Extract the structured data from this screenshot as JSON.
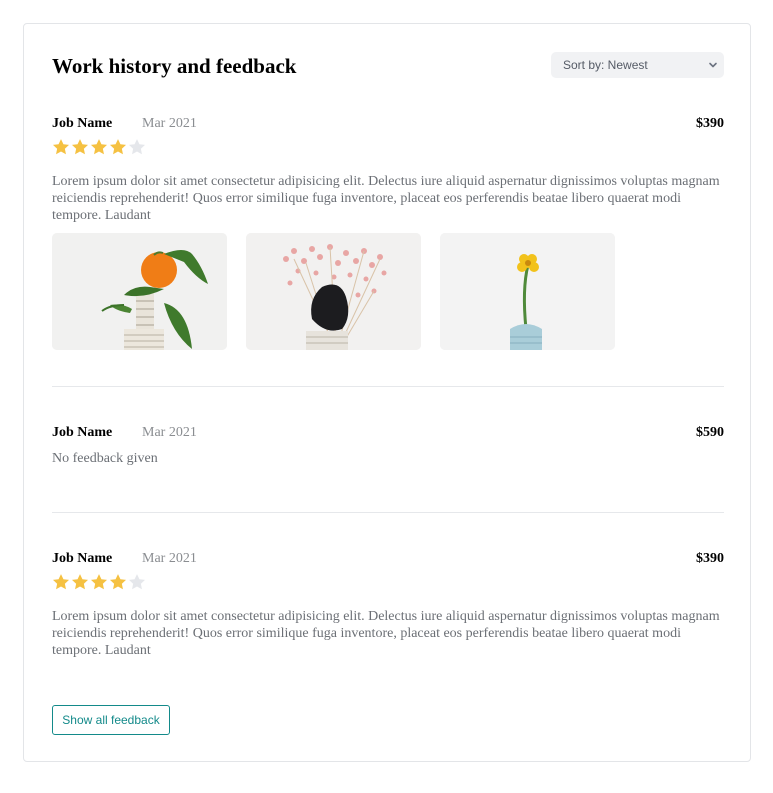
{
  "title": "Work history and feedback",
  "sort": {
    "label": "Sort by: Newest",
    "icon": "chevron-down-icon"
  },
  "colors": {
    "star_filled": "#f5c142",
    "star_empty": "#e5e7eb",
    "accent": "#138a8a"
  },
  "jobs": [
    {
      "name": "Job Name",
      "date": "Mar 2021",
      "price": "$390",
      "rating": 4,
      "rating_max": 5,
      "feedback": "Lorem ipsum dolor sit amet consectetur adipisicing elit. Delectus iure aliquid aspernatur dignissimos voluptas magnam reiciendis reprehenderit! Quos error similique fuga inventore, placeat eos perferendis beatae libero quaerat modi tempore. Laudant",
      "images": [
        "orange-on-stand-photo",
        "dried-flowers-rock-photo",
        "yellow-flower-vase-photo"
      ]
    },
    {
      "name": "Job Name",
      "date": "Mar 2021",
      "price": "$590",
      "feedback": "No feedback given"
    },
    {
      "name": "Job Name",
      "date": "Mar 2021",
      "price": "$390",
      "rating": 4,
      "rating_max": 5,
      "feedback": "Lorem ipsum dolor sit amet consectetur adipisicing elit. Delectus iure aliquid aspernatur dignissimos voluptas magnam reiciendis reprehenderit! Quos error similique fuga inventore, placeat eos perferendis beatae libero quaerat modi tempore. Laudant"
    }
  ],
  "show_all_label": "Show all feedback"
}
